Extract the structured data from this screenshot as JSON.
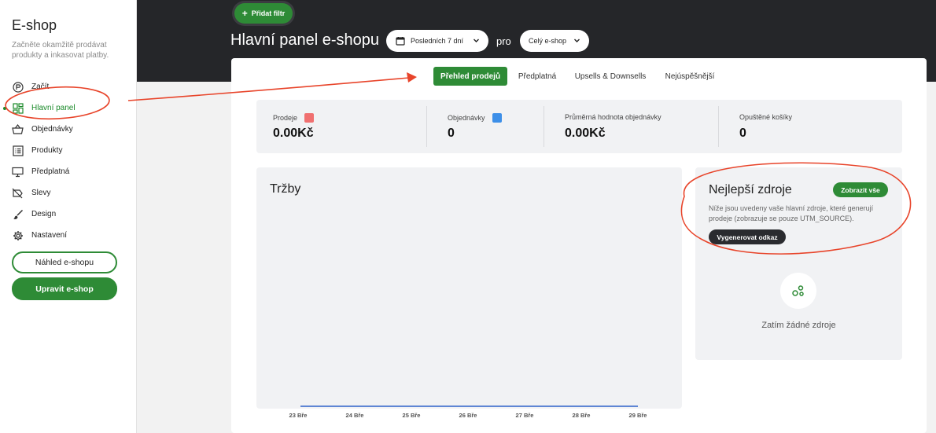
{
  "sidebar": {
    "brand": "E-shop",
    "tagline": "Začněte okamžitě prodávat produkty a inkasovat platby.",
    "items": [
      {
        "label": "Začít",
        "icon": "start-icon"
      },
      {
        "label": "Hlavní panel",
        "icon": "dashboard-icon",
        "active": true
      },
      {
        "label": "Objednávky",
        "icon": "basket-icon"
      },
      {
        "label": "Produkty",
        "icon": "list-icon"
      },
      {
        "label": "Předplatná",
        "icon": "monitor-icon"
      },
      {
        "label": "Slevy",
        "icon": "tag-off-icon"
      },
      {
        "label": "Design",
        "icon": "brush-icon"
      },
      {
        "label": "Nastavení",
        "icon": "gear-icon"
      }
    ],
    "preview_button": "Náhled e-shopu",
    "edit_button": "Upravit e-shop"
  },
  "header": {
    "add_filter": "Přidat filtr",
    "title": "Hlavní panel e-shopu",
    "date_range": "Posledních 7 dní",
    "pro_label": "pro",
    "shop_scope": "Celý e-shop"
  },
  "tabs": [
    {
      "label": "Přehled prodejů",
      "active": true
    },
    {
      "label": "Předplatná"
    },
    {
      "label": "Upsells & Downsells"
    },
    {
      "label": "Nejúspěšnější"
    }
  ],
  "stats": [
    {
      "label": "Prodeje",
      "value": "0.00Kč",
      "color": "#f07070"
    },
    {
      "label": "Objednávky",
      "value": "0",
      "color": "#3d8fe8"
    },
    {
      "label": "Průměrná hodnota objednávky",
      "value": "0.00Kč"
    },
    {
      "label": "Opuštěné košíky",
      "value": "0"
    }
  ],
  "revenue": {
    "title": "Tržby"
  },
  "chart_data": {
    "type": "line",
    "title": "Tržby",
    "categories": [
      "23 Bře",
      "24 Bře",
      "25 Bře",
      "26 Bře",
      "27 Bře",
      "28 Bře",
      "29 Bře"
    ],
    "series": [
      {
        "values": [
          0,
          0,
          0,
          0,
          0,
          0,
          0
        ],
        "color": "#2f63c9"
      }
    ],
    "grid": false
  },
  "sources": {
    "title": "Nejlepší zdroje",
    "show_all": "Zobrazit vše",
    "description": "Níže jsou uvedeny vaše hlavní zdroje, které generují prodeje (zobrazuje se pouze UTM_SOURCE).",
    "generate_link": "Vygenerovat odkaz",
    "empty_text": "Zatím žádné zdroje"
  },
  "colors": {
    "accent": "#2e8b36",
    "header_bg": "#252629",
    "annotation": "#e8442a"
  }
}
